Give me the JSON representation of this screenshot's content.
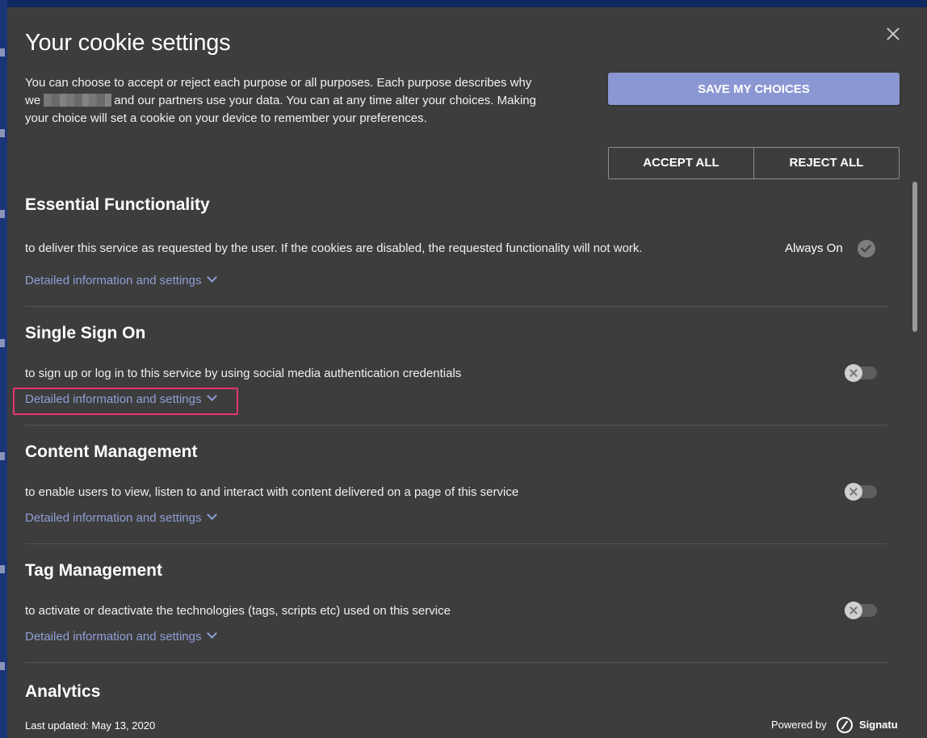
{
  "modal": {
    "title": "Your cookie settings",
    "intro_part1": "You can choose to accept or reject each purpose or all purposes. Each purpose describes why we",
    "intro_part2": "and our partners use your data. You can at any time alter your choices. Making your choice will set a cookie on your device to remember your preferences.",
    "save_label": "SAVE MY CHOICES",
    "accept_all_label": "ACCEPT ALL",
    "reject_all_label": "REJECT ALL"
  },
  "sections": [
    {
      "title": "Essential Functionality",
      "description": "to deliver this service as requested by the user. If the cookies are disabled, the requested functionality will not work.",
      "link": "Detailed information and settings",
      "status": "Always On",
      "state": "always-on"
    },
    {
      "title": "Single Sign On",
      "description": "to sign up or log in to this service by using social media authentication credentials",
      "link": "Detailed information and settings",
      "state": "off"
    },
    {
      "title": "Content Management",
      "description": "to enable users to view, listen to and interact with content delivered on a page of this service",
      "link": "Detailed information and settings",
      "state": "off"
    },
    {
      "title": "Tag Management",
      "description": "to activate or deactivate the technologies (tags, scripts etc) used on this service",
      "link": "Detailed information and settings",
      "state": "off"
    },
    {
      "title": "Analytics"
    }
  ],
  "footer": {
    "last_updated": "Last updated: May 13, 2020",
    "powered_by": "Powered by",
    "brand": "Signatu"
  },
  "colors": {
    "modal_bg": "#3d3d3d",
    "accent": "#8a97d2",
    "link": "#8f9ed6",
    "focus": "#e8366c"
  }
}
